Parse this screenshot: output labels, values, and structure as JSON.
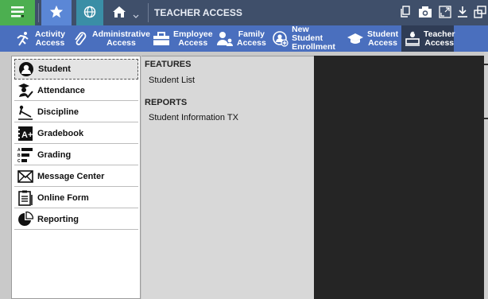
{
  "topbar": {
    "title": "TEACHER ACCESS",
    "left_icons": [
      "menu-icon",
      "star-icon",
      "globe-icon",
      "home-icon",
      "chevron-down-icon"
    ],
    "right_icons": [
      "copy-icon",
      "camera-icon",
      "resize-icon",
      "download-icon",
      "window-icon"
    ],
    "colors": {
      "bar": "#3f4f6a",
      "menu": "#4caf50",
      "star": "#5b87d6",
      "globe": "#3a8ea6"
    }
  },
  "nav": {
    "items": [
      {
        "line1": "Activity",
        "line2": "Access",
        "icon": "runner-icon"
      },
      {
        "line1": "Administrative",
        "line2": "Access",
        "icon": "paperclip-icon"
      },
      {
        "line1": "Employee",
        "line2": "Access",
        "icon": "briefcase-icon"
      },
      {
        "line1": "Family",
        "line2": "Access",
        "icon": "family-icon"
      },
      {
        "line1": "New Student",
        "line2": "Enrollment",
        "icon": "student-plus-icon"
      },
      {
        "line1": "Student",
        "line2": "Access",
        "icon": "grad-cap-icon"
      },
      {
        "line1": "Teacher",
        "line2": "Access",
        "icon": "teacher-desk-icon"
      }
    ],
    "active": "Teacher Access",
    "color": "#4a6fbe"
  },
  "sidebar": {
    "items": [
      {
        "label": "Student",
        "icon": "student-icon"
      },
      {
        "label": "Attendance",
        "icon": "attendance-icon"
      },
      {
        "label": "Discipline",
        "icon": "discipline-icon"
      },
      {
        "label": "Gradebook",
        "icon": "gradebook-icon"
      },
      {
        "label": "Grading",
        "icon": "grading-icon"
      },
      {
        "label": "Message Center",
        "icon": "envelope-icon"
      },
      {
        "label": "Online Form",
        "icon": "clipboard-icon"
      },
      {
        "label": "Reporting",
        "icon": "pie-chart-icon"
      }
    ],
    "selected": "Student"
  },
  "panel": {
    "features_title": "FEATURES",
    "features": [
      "Student List"
    ],
    "reports_title": "REPORTS",
    "reports": [
      "Student Information TX"
    ]
  }
}
